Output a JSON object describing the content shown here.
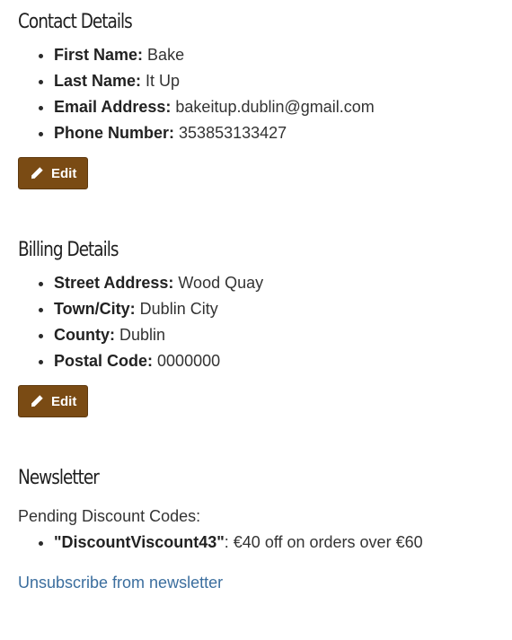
{
  "contact": {
    "title": "Contact Details",
    "items": [
      {
        "label": "First Name:",
        "value": "Bake"
      },
      {
        "label": "Last Name:",
        "value": "It Up"
      },
      {
        "label": "Email Address:",
        "value": "bakeitup.dublin@gmail.com"
      },
      {
        "label": "Phone Number:",
        "value": "353853133427"
      }
    ],
    "edit_label": "Edit"
  },
  "billing": {
    "title": "Billing Details",
    "items": [
      {
        "label": "Street Address:",
        "value": "Wood Quay"
      },
      {
        "label": "Town/City:",
        "value": "Dublin City"
      },
      {
        "label": "County:",
        "value": "Dublin"
      },
      {
        "label": "Postal Code:",
        "value": "0000000"
      }
    ],
    "edit_label": "Edit"
  },
  "newsletter": {
    "title": "Newsletter",
    "pending_label": "Pending Discount Codes:",
    "codes": [
      {
        "code": "\"DiscountViscount43\"",
        "description": ": €40 off on orders over €60"
      }
    ],
    "unsubscribe_label": "Unsubscribe from newsletter"
  },
  "colors": {
    "button_bg": "#7a4b14",
    "link": "#3b6e9e"
  },
  "icons": {
    "edit": "pencil-icon"
  }
}
